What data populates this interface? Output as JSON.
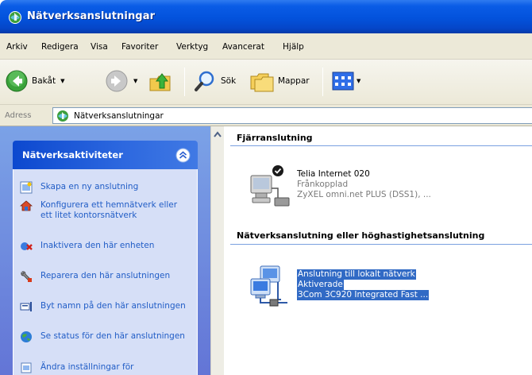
{
  "window": {
    "title": "Nätverksanslutningar"
  },
  "menu": [
    "Arkiv",
    "Redigera",
    "Visa",
    "Favoriter",
    "Verktyg",
    "Avancerat",
    "Hjälp"
  ],
  "toolbar": {
    "back_label": "Bakåt",
    "search_label": "Sök",
    "folders_label": "Mappar"
  },
  "address": {
    "label": "Adress",
    "value": "Nätverksanslutningar"
  },
  "task_pane": {
    "title": "Nätverksaktiviteter",
    "tasks": [
      "Skapa en ny anslutning",
      "Konfigurera ett hemnätverk eller ett litet kontorsnätverk",
      "Inaktivera den här enheten",
      "Reparera den här anslutningen",
      "Byt namn på den här anslutningen",
      "Se status för den här anslutningen",
      "Ändra inställningar för"
    ]
  },
  "groups": [
    {
      "header": "Fjärranslutning",
      "connection": {
        "name": "Telia Internet 020",
        "status": "Frånkopplad",
        "device": "ZyXEL omni.net PLUS (DSS1), ..."
      }
    },
    {
      "header": "Nätverksanslutning eller höghastighetsanslutning",
      "connection": {
        "name": "Anslutning till lokalt nätverk",
        "status": "Aktiverade",
        "device": "3Com 3C920 Integrated Fast ..."
      }
    }
  ],
  "colors": {
    "title_bar": "#0352dc",
    "task_link": "#215dc6",
    "selection": "#316ac5",
    "task_pane_bg": "#6375d6"
  }
}
